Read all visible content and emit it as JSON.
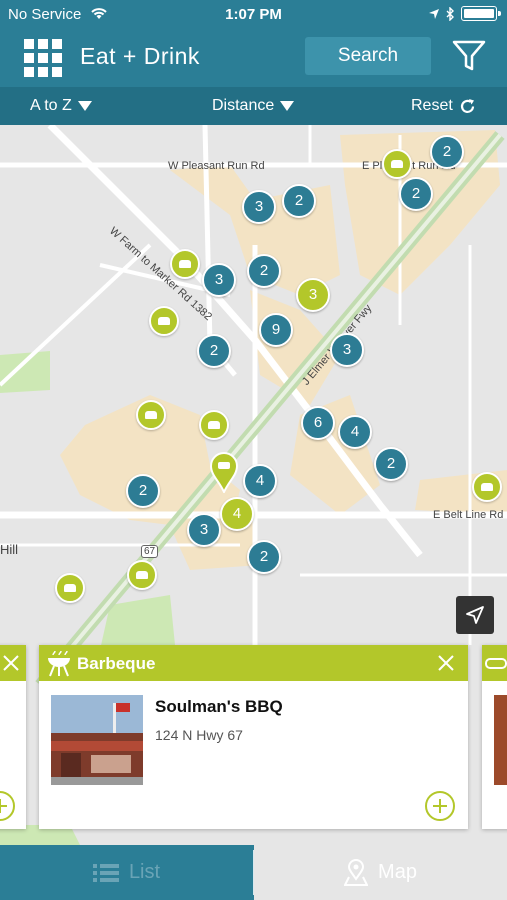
{
  "status_bar": {
    "carrier": "No Service",
    "time": "1:07 PM"
  },
  "header": {
    "title": "Eat + Drink",
    "search_label": "Search"
  },
  "sort_bar": {
    "az_label": "A to Z",
    "distance_label": "Distance",
    "reset_label": "Reset"
  },
  "map": {
    "road_labels": [
      "W Pleasant Run Rd",
      "E Pleasant Run Rd",
      "W Farm to Marker Rd 1382",
      "J Elmer Weaver Fwy",
      "E Belt Line Rd",
      "Hill",
      "67"
    ],
    "clusters": [
      {
        "count": "2",
        "color": "blue"
      },
      {
        "count": "2",
        "color": "blue"
      },
      {
        "count": "3",
        "color": "blue"
      },
      {
        "count": "2",
        "color": "blue"
      },
      {
        "count": "3",
        "color": "blue"
      },
      {
        "count": "2",
        "color": "blue"
      },
      {
        "count": "3",
        "color": "green"
      },
      {
        "count": "9",
        "color": "blue"
      },
      {
        "count": "2",
        "color": "blue"
      },
      {
        "count": "3",
        "color": "blue"
      },
      {
        "count": "6",
        "color": "blue"
      },
      {
        "count": "4",
        "color": "blue"
      },
      {
        "count": "2",
        "color": "blue"
      },
      {
        "count": "4",
        "color": "blue"
      },
      {
        "count": "2",
        "color": "blue"
      },
      {
        "count": "4",
        "color": "green"
      },
      {
        "count": "3",
        "color": "blue"
      },
      {
        "count": "2",
        "color": "blue"
      }
    ]
  },
  "card": {
    "category": "Barbeque",
    "name": "Soulman's BBQ",
    "address": "124 N Hwy 67"
  },
  "tabs": {
    "list_label": "List",
    "map_label": "Map"
  },
  "colors": {
    "header": "#2b7e96",
    "accent_green": "#b3c72a",
    "cluster_blue": "#2d7c94"
  }
}
